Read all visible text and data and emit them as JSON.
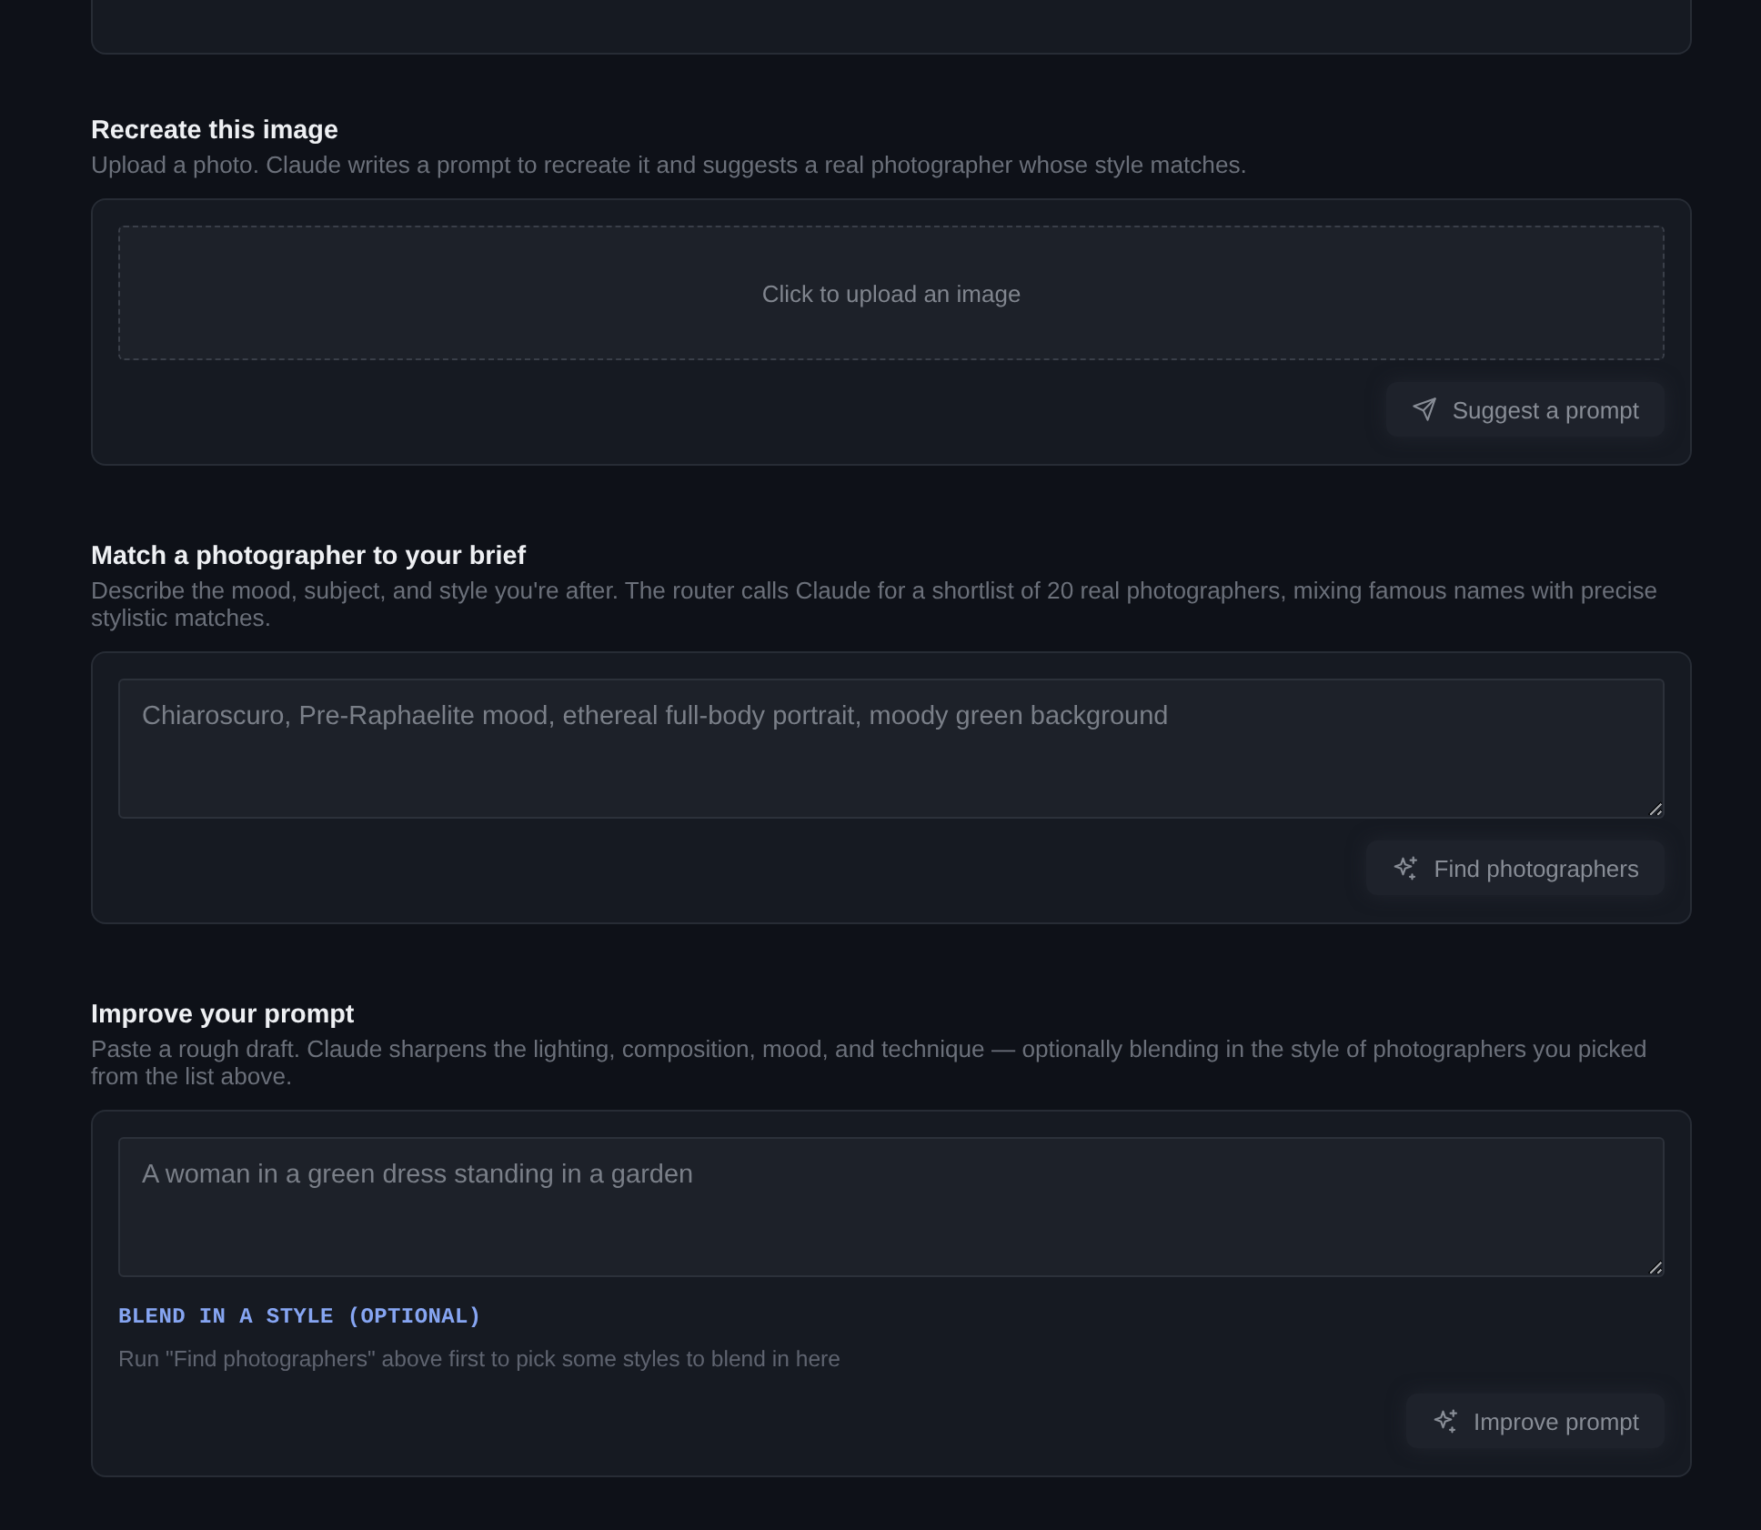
{
  "sections": [
    {
      "title": "Recreate this image",
      "description": "Upload a photo. Claude writes a prompt to recreate it and suggests a real photographer whose style matches.",
      "input": {
        "kind": "upload",
        "label": "Click to upload an image"
      },
      "button": {
        "kind": "suggest",
        "label": "Suggest a prompt",
        "disabled": true
      }
    },
    {
      "title": "Match a photographer to your brief",
      "description": "Describe the mood, subject, and style you're after. The router calls Claude for a shortlist of 20 real photographers, mixing famous names with precise stylistic matches.",
      "input": {
        "kind": "textarea",
        "placeholder": "Chiaroscuro, Pre-Raphaelite mood, ethereal full-body portrait, moody green background"
      },
      "button": {
        "kind": "generate",
        "label": "Find photographers",
        "disabled": true
      }
    },
    {
      "title": "Improve your prompt",
      "description": "Paste a rough draft. Claude sharpens the lighting, composition, mood, and technique — optionally blending in the style of photographers you picked from the list above.",
      "input": {
        "kind": "textarea",
        "placeholder": "A woman in a green dress standing in a garden"
      },
      "blend": {
        "label": "BLEND IN A STYLE (OPTIONAL)",
        "hint": "Run \"Find photographers\" above first to pick some styles to blend in here"
      },
      "button": {
        "kind": "generate",
        "label": "Improve prompt",
        "disabled": true
      }
    }
  ]
}
